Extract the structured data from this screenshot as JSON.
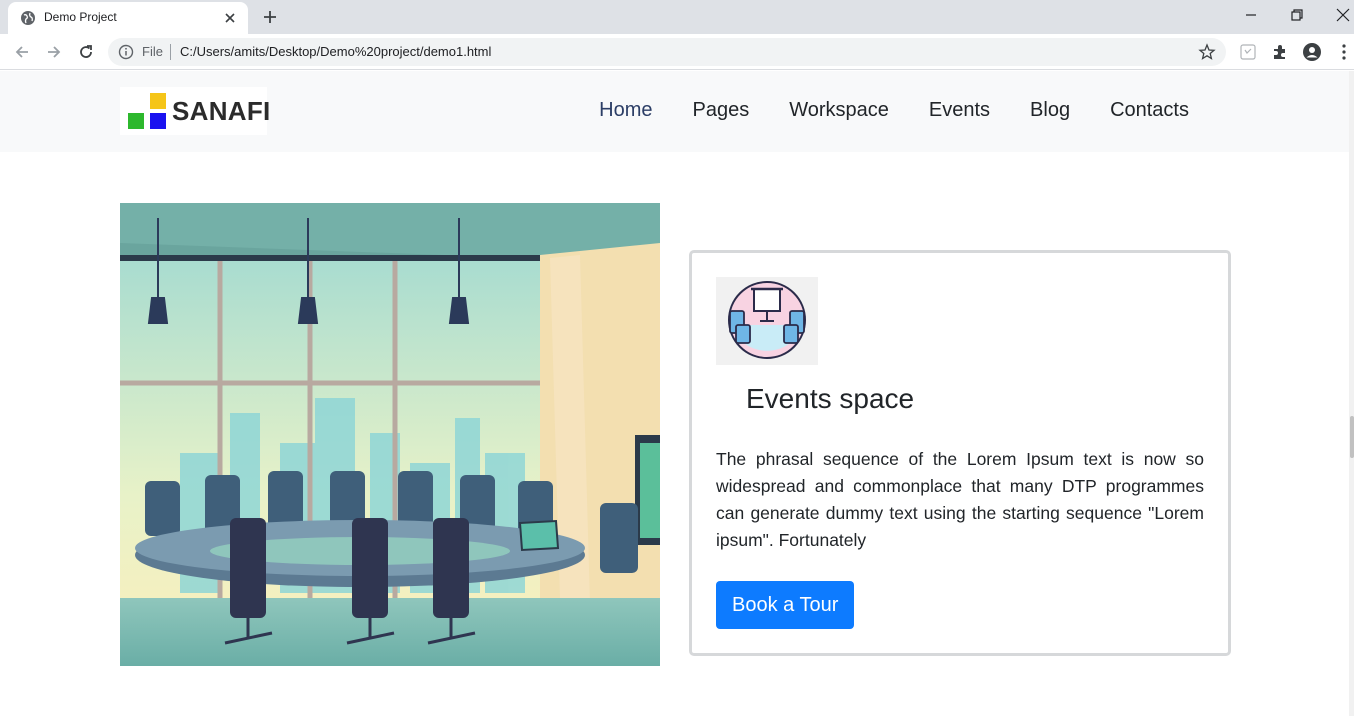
{
  "browser": {
    "tab_title": "Demo Project",
    "address_scheme_label": "File",
    "url": "C:/Users/amits/Desktop/Demo%20project/demo1.html"
  },
  "site": {
    "logo_text": "SANAFI",
    "logo_colors": {
      "yellow": "#f5c518",
      "green": "#2db82d",
      "blue": "#1a12f0"
    },
    "nav": [
      "Home",
      "Pages",
      "Workspace",
      "Events",
      "Blog",
      "Contacts"
    ],
    "active_nav": "Home"
  },
  "card": {
    "title": "Events space",
    "text": "The phrasal sequence of the Lorem Ipsum text is now so widespread and commonplace that many DTP programmes can generate dummy text using the starting sequence \"Lorem ipsum\". Fortunately",
    "button_label": "Book a Tour",
    "accent": "#0d7bff"
  },
  "icons": {
    "tab_favicon": "globe-icon",
    "tab_close": "close-icon",
    "new_tab": "plus-icon",
    "back": "arrow-left-icon",
    "forward": "arrow-right-icon",
    "reload": "reload-icon",
    "site_info": "info-icon",
    "bookmark": "star-icon",
    "extensions": "puzzle-icon",
    "profile": "avatar-icon",
    "menu": "kebab-menu-icon",
    "event_icon": "presentation-room-icon"
  }
}
